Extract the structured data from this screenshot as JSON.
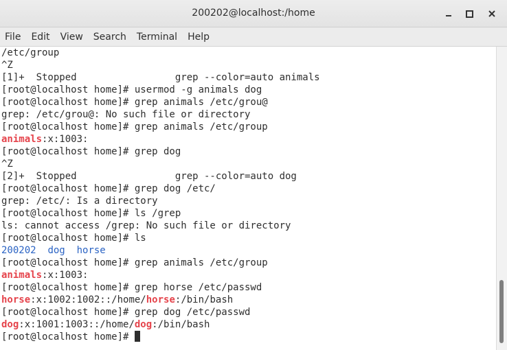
{
  "window": {
    "title": "200202@localhost:/home"
  },
  "menu": {
    "file": "File",
    "edit": "Edit",
    "view": "View",
    "search": "Search",
    "terminal": "Terminal",
    "help": "Help"
  },
  "icons": {
    "minimize": "minimize-icon",
    "maximize": "maximize-icon",
    "close": "close-icon"
  },
  "colors": {
    "match_highlight": "#e5434b",
    "directory": "#2a63c4",
    "text": "#2e2e2e"
  },
  "terminal": {
    "lines": {
      "l1": "/etc/group",
      "l2": "^Z",
      "l3": "[1]+  Stopped                 grep --color=auto animals",
      "l4": "[root@localhost home]# usermod -g animals dog",
      "l5": "[root@localhost home]# grep animals /etc/grou@",
      "l6": "grep: /etc/grou@: No such file or directory",
      "l7": "[root@localhost home]# grep animals /etc/group",
      "l8_match": "animals",
      "l8_rest": ":x:1003:",
      "l9": "[root@localhost home]# grep dog",
      "l10": "^Z",
      "l11": "[2]+  Stopped                 grep --color=auto dog",
      "l12": "[root@localhost home]# grep dog /etc/",
      "l13": "grep: /etc/: Is a directory",
      "l14": "[root@localhost home]# ls /grep",
      "l15": "ls: cannot access /grep: No such file or directory",
      "l16": "[root@localhost home]# ls",
      "l17_a": "200202",
      "l17_b": "dog",
      "l17_c": "horse",
      "l18": "[root@localhost home]# grep animals /etc/group",
      "l19_match": "animals",
      "l19_rest": ":x:1003:",
      "l20": "[root@localhost home]# grep horse /etc/passwd",
      "l21_m1": "horse",
      "l21_mid": ":x:1002:1002::/home/",
      "l21_m2": "horse",
      "l21_end": ":/bin/bash",
      "l22": "[root@localhost home]# grep dog /etc/passwd",
      "l23_m1": "dog",
      "l23_mid": ":x:1001:1003::/home/",
      "l23_m2": "dog",
      "l23_end": ":/bin/bash",
      "l24": "[root@localhost home]# "
    }
  }
}
